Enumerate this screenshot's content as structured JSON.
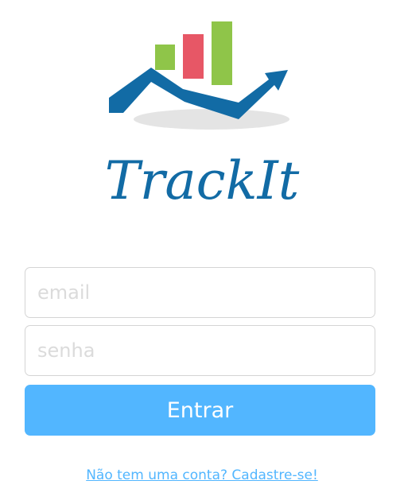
{
  "logo": {
    "name": "TrackIt",
    "colors": {
      "blue": "#126ba5",
      "green": "#8fc549",
      "red": "#e75766",
      "shadow": "#e4e4e4"
    }
  },
  "form": {
    "email_placeholder": "email",
    "password_placeholder": "senha",
    "submit_label": "Entrar",
    "accent": "#52b6ff"
  },
  "signup": {
    "link_text": "Não tem uma conta? Cadastre-se!"
  }
}
